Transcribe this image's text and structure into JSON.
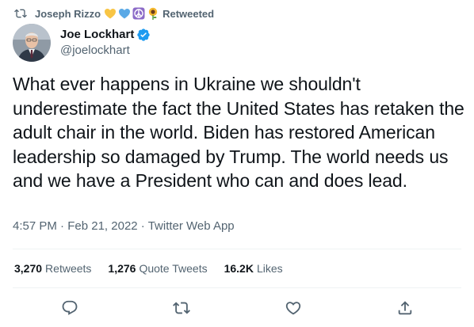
{
  "retweet_context": {
    "retweeter_name": "Joseph Rizzo",
    "emoji_icons": [
      "yellow-heart-icon",
      "blue-heart-icon",
      "peace-sign-icon",
      "sunflower-icon"
    ],
    "label": "Retweeted"
  },
  "author": {
    "display_name": "Joe Lockhart",
    "handle": "@joelockhart",
    "verified": true
  },
  "tweet": {
    "text": "What ever happens in Ukraine we shouldn't underestimate the fact the United States has retaken the adult chair in the world. Biden has restored American leadership so damaged by Trump. The world needs us and we have a President who can and does lead.",
    "time": "4:57 PM",
    "separator": "·",
    "date": "Feb 21, 2022",
    "source": "Twitter Web App"
  },
  "stats": {
    "retweets": {
      "count": "3,270",
      "label": "Retweets"
    },
    "quote_tweets": {
      "count": "1,276",
      "label": "Quote Tweets"
    },
    "likes": {
      "count": "16.2K",
      "label": "Likes"
    }
  },
  "actions": [
    "reply-icon",
    "retweet-icon",
    "like-icon",
    "share-icon"
  ],
  "colors": {
    "text_primary": "#0f1419",
    "text_secondary": "#536471",
    "divider": "#eff3f4",
    "verified_blue": "#1d9bf0"
  }
}
